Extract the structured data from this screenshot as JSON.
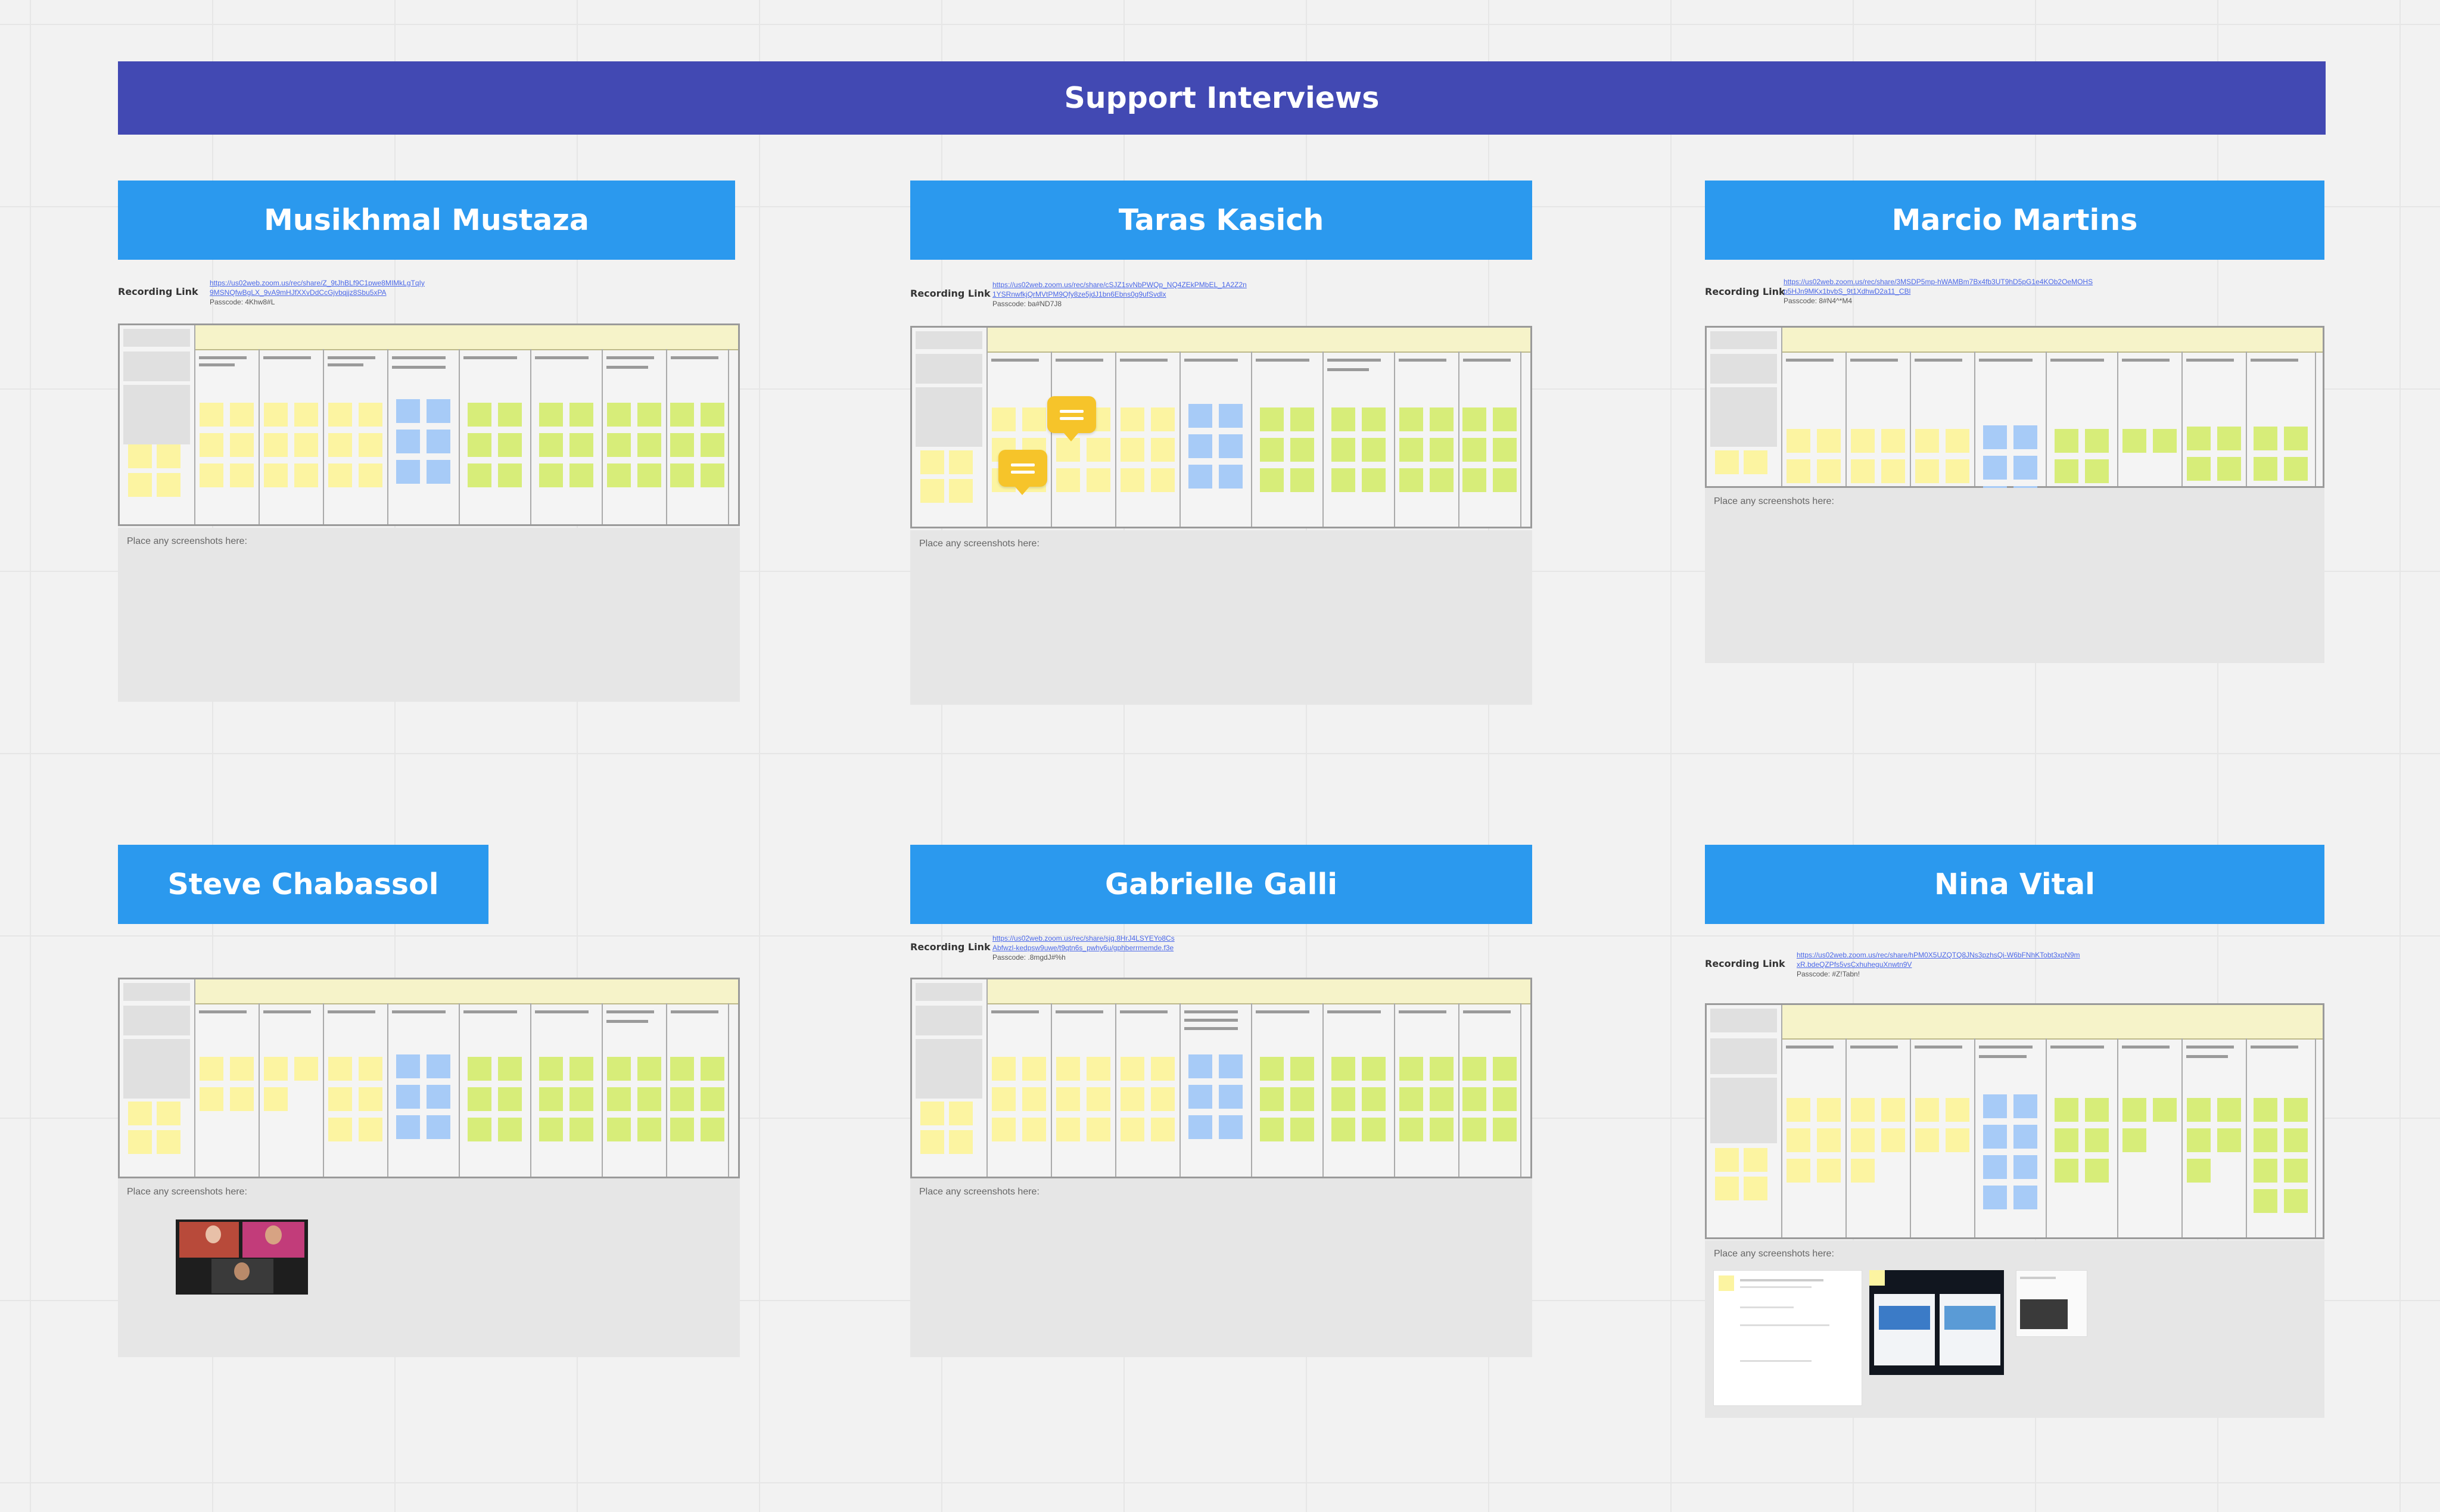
{
  "board_title": "Support Interviews",
  "recording_label": "Recording Link",
  "screenshot_placeholder": "Place any screenshots here:",
  "colors": {
    "banner": "#4249b3",
    "header": "#2b99ee",
    "sticky_yellow": "#fcf4a1",
    "sticky_green": "#d7ed79",
    "sticky_blue": "#a7cbf7",
    "comment": "#f6c42a"
  },
  "interviews": [
    {
      "name": "Musikhmal Mustaza",
      "link_line1": "https://us02web.zoom.us/rec/share/Z_9tJhBLf9C1pwe8MIMkLgTqIy",
      "link_line2": "9MSNQfwBgLX_9vA9mHJfXXvDdCcGjvbqjjz8Sbu5xPA",
      "passcode": "Passcode: 4Khw8#L"
    },
    {
      "name": "Taras Kasich",
      "link_line1": "https://us02web.zoom.us/rec/share/cSJZ1svNbPWQp_NQ4ZEkPMbEL_1A2Z2n",
      "link_line2": "1YSRnwfkjQrMVtPM9Qfy8ze5jdJ1bn6Ebns0g9ufSvdlx",
      "passcode": "Passcode: ba#ND7J8"
    },
    {
      "name": "Marcio Martins",
      "link_line1": "https://us02web.zoom.us/rec/share/3MSDP5mp-hWAMBm7Bx4fb3UT9hD5pG1e4KOb2OeMOHS",
      "link_line2": "p5HJn9MKx1bvbS_9t1XdhwD2a11_CBl",
      "passcode": "Passcode: 8#N4^*M4"
    },
    {
      "name": "Steve Chabassol",
      "link_line1": "",
      "link_line2": "",
      "passcode": ""
    },
    {
      "name": "Gabrielle Galli",
      "link_line1": "https://us02web.zoom.us/rec/share/sjq.8HrJ4LSYEYo8Cs",
      "link_line2": "Abfwzl-kedpsw9uwe/t9qtn6s_pwhy6u/gphberrmemde.f3e",
      "passcode": "Passcode: .8mgdJ#%h"
    },
    {
      "name": "Nina Vital",
      "link_line1": "https://us02web.zoom.us/rec/share/hPM0X5UZQTQ8JNs3pzhsQi-W6bFNhKTobt3xpN9m",
      "link_line2": "xR.bdeQZPfs5vsCxhuheguXnwtn9V",
      "passcode": "Passcode: #Z!Tabn!"
    }
  ]
}
